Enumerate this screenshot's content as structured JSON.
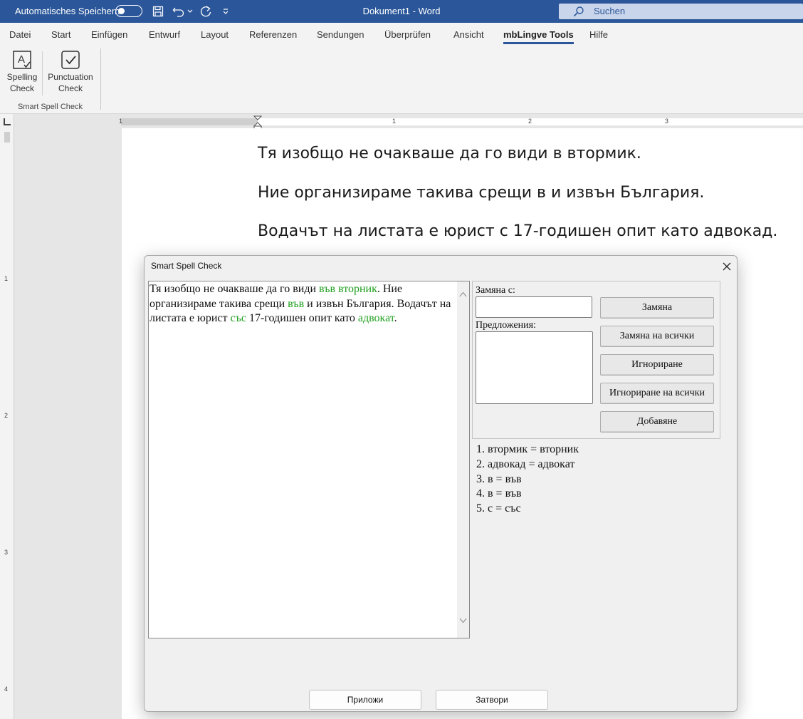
{
  "titlebar": {
    "autosave_label": "Automatisches Speichern",
    "doc_title": "Dokument1  -  Word",
    "search_label": "Suchen"
  },
  "menu": {
    "tabs": [
      "Datei",
      "Start",
      "Einfügen",
      "Entwurf",
      "Layout",
      "Referenzen",
      "Sendungen",
      "Überprüfen",
      "Ansicht",
      "mbLingve Tools",
      "Hilfe"
    ],
    "active_tab": "mbLingve Tools"
  },
  "ribbon": {
    "spelling_line1": "Spelling",
    "spelling_line2": "Check",
    "punct_line1": "Punctuation",
    "punct_line2": "Check",
    "group_label": "Smart Spell Check"
  },
  "ruler": {
    "h_numbers": [
      "1",
      "1",
      "2",
      "3"
    ],
    "v_numbers": [
      "1",
      "2",
      "3",
      "4"
    ]
  },
  "document": {
    "lines": [
      "Тя изобщо не очакваше да го види в втормик.",
      "Ние организираме такива срещи в и извън България.",
      "Водачът на листата е юрист с 17-годишен опит като адвокад."
    ]
  },
  "dialog": {
    "title": "Smart Spell Check",
    "text": {
      "p1": "Тя изобщо не очакваше да го види ",
      "g1": "във вторник",
      "p2": ". Ние организираме такива срещи ",
      "g2": "във",
      "p3": " и извън България. Водачът на листата е юрист ",
      "g3": "със",
      "p4": " 17-годишен опит като ",
      "g4": "адвокат",
      "p5": "."
    },
    "replace_label": "Замяна с:",
    "replace_value": "",
    "suggestions_label": "Предложения:",
    "buttons": {
      "replace": "Замяна",
      "replace_all": "Замяна на всички",
      "ignore": "Игнориране",
      "ignore_all": "Игнориране на всички",
      "add": "Добавяне"
    },
    "corrections": [
      "1. втормик = вторник",
      "2. адвокад = адвокат",
      "3. в = във",
      "4. в = във",
      "5. с = със"
    ],
    "apply_label": "Приложи",
    "close_label": "Затвори"
  },
  "colors": {
    "title_bar": "#2b579a",
    "correction_green": "#1fa01f"
  }
}
